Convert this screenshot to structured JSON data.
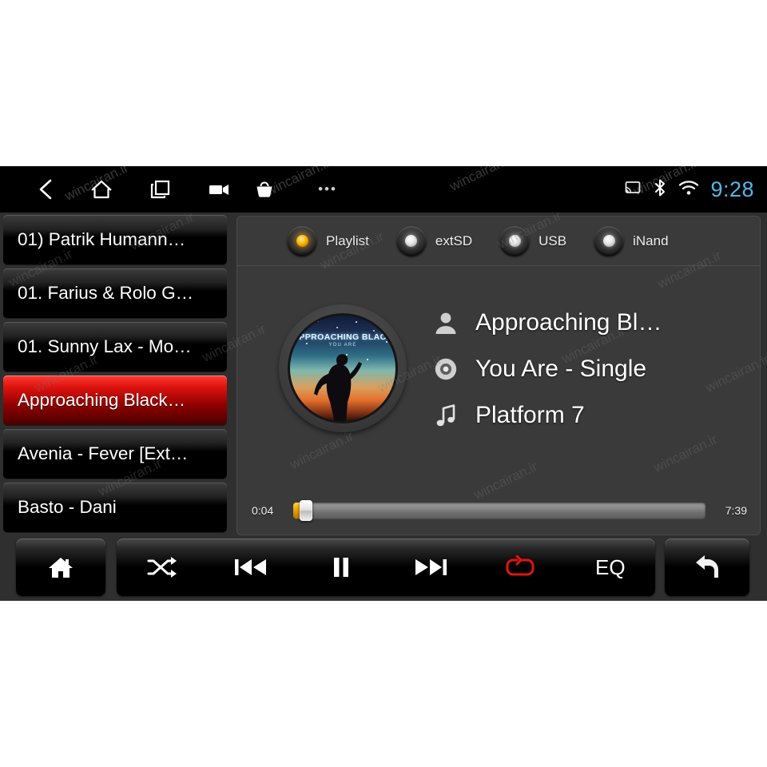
{
  "statusbar": {
    "nav": [
      {
        "name": "back-icon",
        "label": "Back"
      },
      {
        "name": "home-icon",
        "label": "Home"
      },
      {
        "name": "recents-icon",
        "label": "Recent apps"
      },
      {
        "name": "screen-record-icon",
        "label": "Screen record"
      },
      {
        "name": "apps-basket-icon",
        "label": "Apps"
      }
    ],
    "more_dots": "•••",
    "indicators": [
      {
        "name": "cast-icon",
        "label": "Cast"
      },
      {
        "name": "bluetooth-icon",
        "label": "Bluetooth"
      },
      {
        "name": "wifi-icon",
        "label": "Wi-Fi"
      }
    ],
    "clock": "9:28",
    "clock_color": "#57b6e8"
  },
  "playlist": {
    "items": [
      {
        "label": "01) Patrik Humann…",
        "selected": false
      },
      {
        "label": "01. Farius & Rolo G…",
        "selected": false
      },
      {
        "label": "01. Sunny Lax - Mo…",
        "selected": false
      },
      {
        "label": "Approaching Black…",
        "selected": true
      },
      {
        "label": "Avenia - Fever [Ext…",
        "selected": false
      },
      {
        "label": "Basto - Dani",
        "selected": false
      }
    ],
    "selected_color": "#e01410"
  },
  "sources": {
    "items": [
      {
        "label": "Playlist",
        "active": true
      },
      {
        "label": "extSD",
        "active": false
      },
      {
        "label": "USB",
        "active": false
      },
      {
        "label": "iNand",
        "active": false
      }
    ],
    "active_led_color": "#ffb400"
  },
  "album_art": {
    "title": "APPROACHING BLACK",
    "subtitle": "YOU ARE",
    "name": "album-art"
  },
  "track": {
    "rows": [
      {
        "icon": "artist-icon",
        "value": "Approaching Bl…"
      },
      {
        "icon": "album-disc-icon",
        "value": "You Are - Single"
      },
      {
        "icon": "music-note-icon",
        "value": "Platform 7"
      }
    ]
  },
  "progress": {
    "elapsed": "0:04",
    "total": "7:39",
    "percent": 1,
    "fill_color": "#eda400"
  },
  "controls": {
    "home": {
      "label": "Home",
      "icon": "home-icon"
    },
    "transport": [
      {
        "label": "Shuffle",
        "icon": "shuffle-icon",
        "active": false
      },
      {
        "label": "Previous",
        "icon": "previous-track-icon",
        "active": false
      },
      {
        "label": "Pause",
        "icon": "pause-icon",
        "active": false
      },
      {
        "label": "Next",
        "icon": "next-track-icon",
        "active": false
      },
      {
        "label": "Repeat",
        "icon": "repeat-icon",
        "active": true
      },
      {
        "label": "EQ",
        "icon": "equalizer-label",
        "active": false
      }
    ],
    "back": {
      "label": "Return",
      "icon": "return-arrow-icon"
    },
    "active_color": "#e01410",
    "eq_label": "EQ"
  },
  "watermark": {
    "text": "wincairan.ir"
  }
}
